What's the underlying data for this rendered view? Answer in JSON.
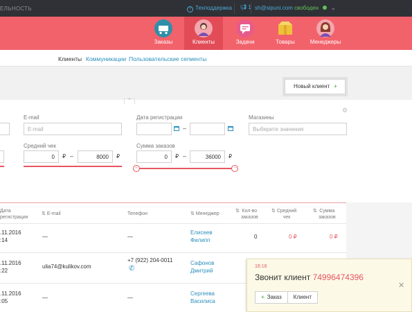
{
  "topbar": {
    "left_text": "ЕЛЬНОСТЬ",
    "support": "Техподдержка",
    "notifications": "1",
    "email": "sh@sipuni.com",
    "status": "свободен"
  },
  "nav": {
    "items": [
      {
        "label": "Заказы",
        "icon": "cart-icon",
        "color": "#2f8fa8"
      },
      {
        "label": "Клиенты",
        "icon": "person-icon",
        "color": "#e76f7a"
      },
      {
        "label": "Задачи",
        "icon": "chat-icon",
        "color": "#e85a8a"
      },
      {
        "label": "Товары",
        "icon": "box-icon",
        "color": "#f0c23a"
      },
      {
        "label": "Менеджеры",
        "icon": "manager-icon",
        "color": "#d94e6a"
      }
    ]
  },
  "subnav": {
    "clients": "Клиенты",
    "communications": "Коммуникации",
    "segments": "Пользовательские сегменты"
  },
  "new_client_button": "Новый клиент",
  "filters": {
    "email_label": "E-mail",
    "email_placeholder": "E-mail",
    "reg_label": "Дата регистрации",
    "shops_label": "Магазины",
    "shops_placeholder": "Выберите значения",
    "avg_check_label": "Средний чек",
    "avg_from": "0",
    "avg_to": "8000",
    "orders_sum_label": "Сумма заказов",
    "sum_from": "0",
    "sum_to": "36000",
    "currency": "₽",
    "dash": "–"
  },
  "table": {
    "headers": {
      "reg_date": "Дата\nрегистрации",
      "email": "E-mail",
      "phone": "Телефон",
      "manager": "Менеджер",
      "orders_count": "Кол-во\nзаказов",
      "avg_check": "Средний\nчек",
      "orders_sum": "Сумма\nзаказов"
    },
    "rows": [
      {
        "date": ".11.2016",
        "time": ":14",
        "email": "—",
        "phone": "—",
        "manager": "Елисеев\nФилипп",
        "orders": "0",
        "avg": "0 ₽",
        "sum": "0 ₽"
      },
      {
        "date": ".11.2016",
        "time": ":22",
        "email": "ulia74@kulikov.com",
        "phone": "+7 (922) 204-0011",
        "manager": "Сафонов\nДмитрий",
        "orders": "",
        "avg": "",
        "sum": ""
      },
      {
        "date": ".11.2016",
        "time": ":05",
        "email": "—",
        "phone": "—",
        "manager": "Сергеева\nВасилиса",
        "orders": "",
        "avg": "",
        "sum": ""
      }
    ]
  },
  "popup": {
    "time": "16:16",
    "message": "Звонит клиент",
    "number": "74996474396",
    "order_button": "Заказ",
    "client_button": "Клиент"
  },
  "colors": {
    "brand_red": "#f2626b",
    "active_red": "#e14c57",
    "link_blue": "#2a8fbd",
    "status_green": "#62c15a"
  }
}
